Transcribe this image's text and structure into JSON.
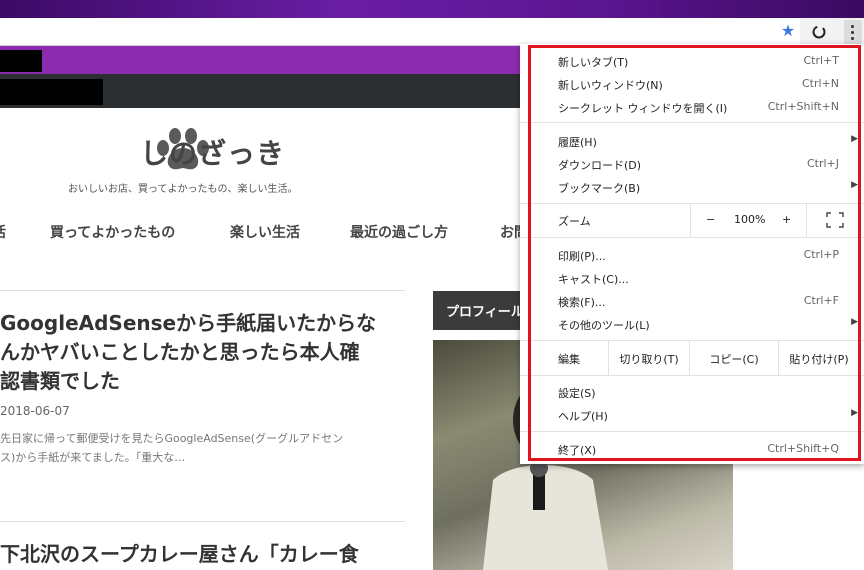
{
  "browser": {
    "star_icon": "star-icon",
    "extension_icon": "sync-icon",
    "menu_icon": "three-dots-icon"
  },
  "site": {
    "logo_text": "しのざっき",
    "tagline": "おいしいお店、買ってよかったもの、楽しい生活。",
    "nav": [
      "活",
      "買ってよかったもの",
      "楽しい生活",
      "最近の過ごし方",
      "お問"
    ]
  },
  "article": {
    "title_lines": [
      "GoogleAdSenseから手紙届いたからな",
      "んかヤバいことしたかと思ったら本人確",
      "認書類でした"
    ],
    "date": "2018-06-07",
    "excerpt_lines": [
      "先日家に帰って郵便受けを見たらGoogleAdSense(グーグルアドセン",
      "ス)から手紙が来てました。「重大な…"
    ],
    "next_title": "下北沢のスープカレー屋さん「カレー食"
  },
  "sidebar": {
    "profile_heading": "プロフィール"
  },
  "menu": {
    "new_tab": {
      "label": "新しいタブ(T)",
      "shortcut": "Ctrl+T"
    },
    "new_window": {
      "label": "新しいウィンドウ(N)",
      "shortcut": "Ctrl+N"
    },
    "incognito": {
      "label": "シークレット ウィンドウを開く(I)",
      "shortcut": "Ctrl+Shift+N"
    },
    "history": {
      "label": "履歴(H)"
    },
    "downloads": {
      "label": "ダウンロード(D)",
      "shortcut": "Ctrl+J"
    },
    "bookmarks": {
      "label": "ブックマーク(B)"
    },
    "zoom": {
      "label": "ズーム",
      "minus": "−",
      "value": "100%",
      "plus": "+"
    },
    "print": {
      "label": "印刷(P)...",
      "shortcut": "Ctrl+P"
    },
    "cast": {
      "label": "キャスト(C)..."
    },
    "find": {
      "label": "検索(F)...",
      "shortcut": "Ctrl+F"
    },
    "more_tools": {
      "label": "その他のツール(L)"
    },
    "edit": {
      "label": "編集",
      "cut": "切り取り(T)",
      "copy": "コピー(C)",
      "paste": "貼り付け(P)"
    },
    "settings": {
      "label": "設定(S)"
    },
    "help": {
      "label": "ヘルプ(H)"
    },
    "exit": {
      "label": "終了(X)",
      "shortcut": "Ctrl+Shift+Q"
    }
  },
  "colors": {
    "highlight_border": "#e0141e",
    "header_purple": "#8d2bb0",
    "header_dark": "#2c2f32"
  }
}
